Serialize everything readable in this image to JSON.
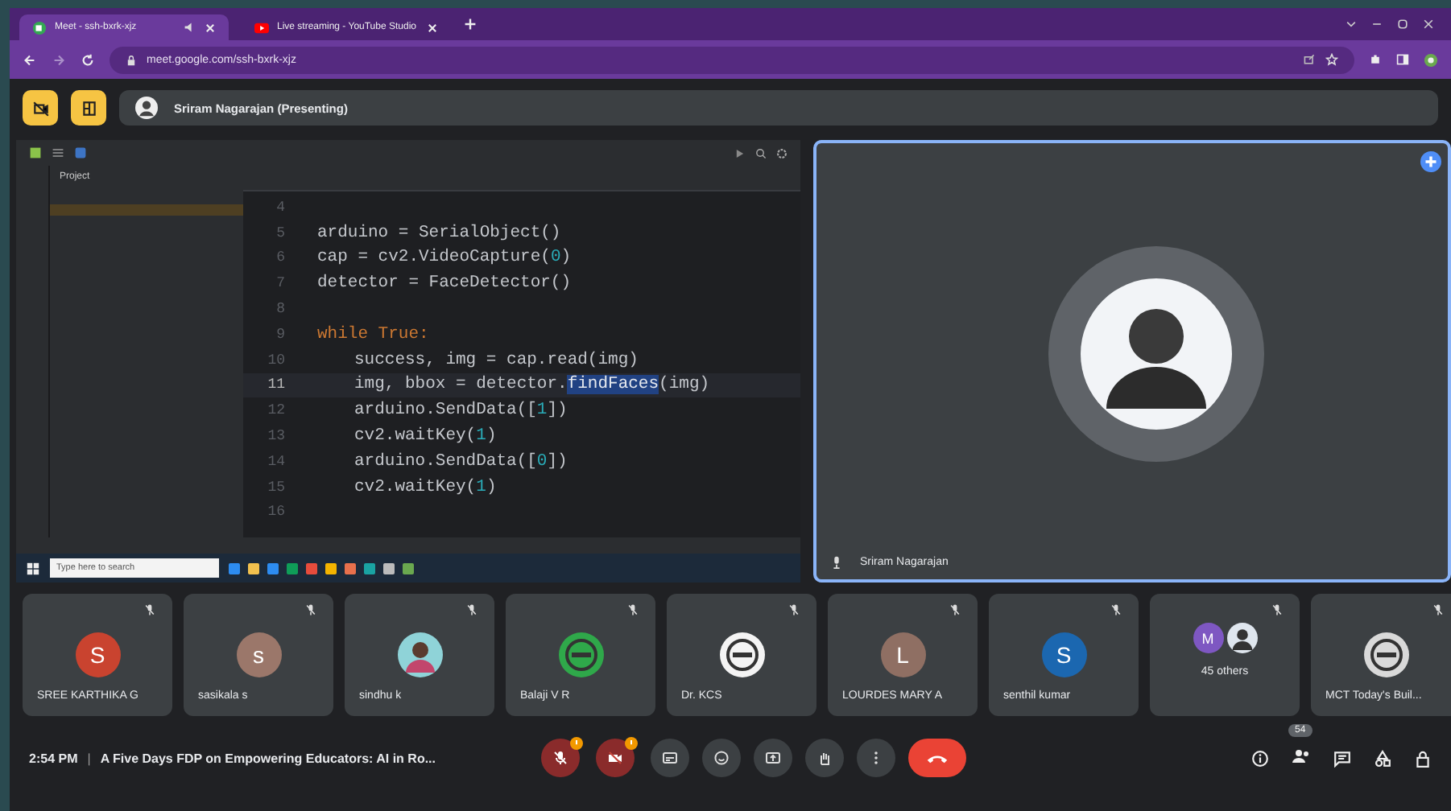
{
  "browser": {
    "tabs": [
      {
        "title": "Meet - ssh-bxrk-xjz",
        "selected": true,
        "audio": true
      },
      {
        "title": "Live streaming - YouTube Studio",
        "selected": false,
        "audio": false
      }
    ],
    "url": "meet.google.com/ssh-bxrk-xjz"
  },
  "presenter": {
    "label": "Sriram Nagarajan (Presenting)"
  },
  "shared_screen": {
    "ide": {
      "panel_title": "Project",
      "code_lines": [
        {
          "number": "4",
          "current": false
        },
        {
          "number": "5",
          "current": false,
          "segments": [
            {
              "text": "arduino = SerialObject()",
              "kind": "plain"
            }
          ]
        },
        {
          "number": "6",
          "current": false,
          "segments": [
            {
              "text": "cap = cv2.VideoCapture(",
              "kind": "plain"
            },
            {
              "text": "0",
              "kind": "number"
            },
            {
              "text": ")",
              "kind": "plain"
            }
          ]
        },
        {
          "number": "7",
          "current": false,
          "segments": [
            {
              "text": "detector = FaceDetector()",
              "kind": "plain"
            }
          ]
        },
        {
          "number": "8",
          "current": false
        },
        {
          "number": "9",
          "current": false,
          "segments": [
            {
              "text": "while True:",
              "kind": "keyword"
            }
          ],
          "children": [
            {
              "number": "10",
              "current": false,
              "segments": [
                {
                  "text": "success, img = cap.read(img)",
                  "kind": "plain"
                }
              ]
            },
            {
              "number": "11",
              "current": true,
              "segments": [
                {
                  "text": "img, bbox = detector.",
                  "kind": "plain"
                },
                {
                  "text": "findFaces",
                  "kind": "selected"
                },
                {
                  "text": "(img)",
                  "kind": "plain"
                }
              ]
            },
            {
              "number": "12",
              "current": false,
              "segments": [
                {
                  "text": "arduino.SendData([",
                  "kind": "plain"
                },
                {
                  "text": "1",
                  "kind": "number"
                },
                {
                  "text": "])",
                  "kind": "plain"
                }
              ]
            },
            {
              "number": "13",
              "current": false,
              "segments": [
                {
                  "text": "cv2.waitKey(",
                  "kind": "plain"
                },
                {
                  "text": "1",
                  "kind": "number"
                },
                {
                  "text": ")",
                  "kind": "plain"
                }
              ]
            },
            {
              "number": "14",
              "current": false,
              "segments": [
                {
                  "text": "arduino.SendData([",
                  "kind": "plain"
                },
                {
                  "text": "0",
                  "kind": "number"
                },
                {
                  "text": "])",
                  "kind": "plain"
                }
              ]
            },
            {
              "number": "15",
              "current": false,
              "segments": [
                {
                  "text": "cv2.waitKey(",
                  "kind": "plain"
                },
                {
                  "text": "1",
                  "kind": "number"
                },
                {
                  "text": ")",
                  "kind": "plain"
                }
              ]
            }
          ]
        },
        {
          "number": "16",
          "current": false
        }
      ]
    },
    "taskbar": {
      "search_placeholder": "Type here to search"
    }
  },
  "speaker": {
    "name": "Sriram Nagarajan"
  },
  "participants": [
    {
      "name": "SREE KARTHIKA G",
      "kind": "letter",
      "initial": "S",
      "color": "#c9432f"
    },
    {
      "name": "sasikala s",
      "kind": "letter",
      "initial": "s",
      "color": "#9b776a"
    },
    {
      "name": "sindhu k",
      "kind": "photo"
    },
    {
      "name": "Balaji V R",
      "kind": "logo",
      "color": "#2fa84a"
    },
    {
      "name": "Dr. KCS",
      "kind": "logo",
      "color": "#f4f4f4"
    },
    {
      "name": "LOURDES MARY A",
      "kind": "letter",
      "initial": "L",
      "color": "#8f6f63"
    },
    {
      "name": "senthil kumar",
      "kind": "letter",
      "initial": "S",
      "color": "#1b67b0"
    },
    {
      "name": "45 others",
      "kind": "others",
      "avatars": [
        {
          "kind": "letter",
          "initial": "M",
          "color": "#7e57c2"
        },
        {
          "kind": "photo"
        }
      ]
    },
    {
      "name": "MCT Today's Buil...",
      "kind": "logo",
      "color": "#d9d9d9"
    }
  ],
  "bottom_bar": {
    "time": "2:54 PM",
    "separator": "|",
    "meeting_title": "A Five Days FDP on Empowering Educators: AI in Ro...",
    "controls": [
      {
        "kind": "mic",
        "on": false,
        "alert": true
      },
      {
        "kind": "camera",
        "on": false,
        "alert": true
      },
      {
        "kind": "captions"
      },
      {
        "kind": "reactions"
      },
      {
        "kind": "present"
      },
      {
        "kind": "hand"
      },
      {
        "kind": "more"
      },
      {
        "kind": "end"
      }
    ],
    "people_count": "54"
  }
}
